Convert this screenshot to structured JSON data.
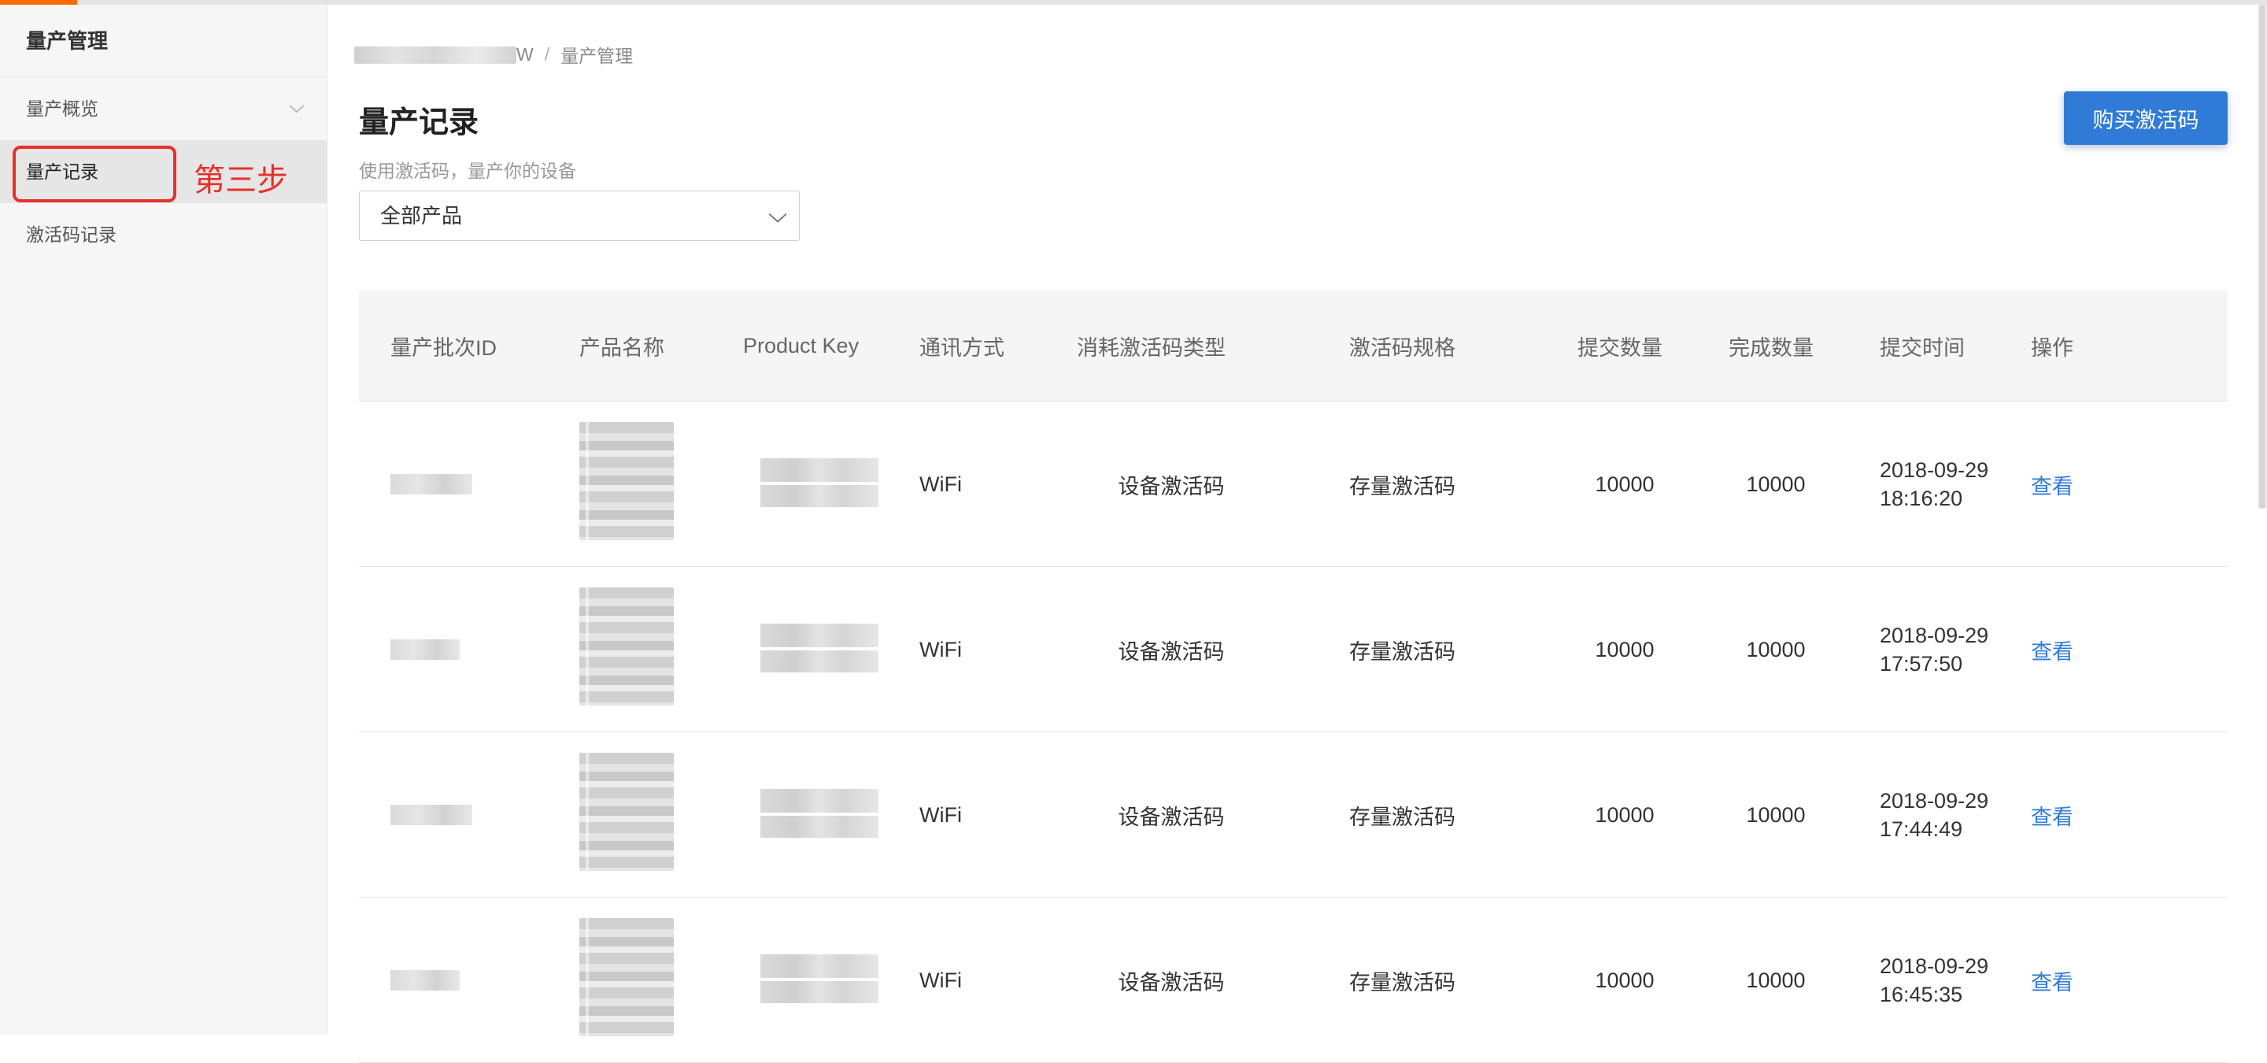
{
  "sidebar": {
    "title": "量产管理",
    "items": [
      {
        "label": "量产概览",
        "has_chevron": true
      },
      {
        "label": "量产记录",
        "active": true
      },
      {
        "label": "激活码记录"
      }
    ]
  },
  "annotation": {
    "step_label": "第三步",
    "color": "#e8302a"
  },
  "breadcrumb": {
    "current": "量产管理",
    "separator": "/",
    "prefix_suffix": "W"
  },
  "page": {
    "title": "量产记录",
    "description": "使用激活码，量产你的设备",
    "buy_button_label": "购买激活码",
    "product_filter": "全部产品"
  },
  "table": {
    "headers": [
      "量产批次ID",
      "产品名称",
      "Product Key",
      "通讯方式",
      "消耗激活码类型",
      "激活码规格",
      "提交数量",
      "完成数量",
      "提交时间",
      "操作"
    ],
    "rows": [
      {
        "comm": "WiFi",
        "code_type": "设备激活码",
        "spec": "存量激活码",
        "submitted": "10000",
        "completed": "10000",
        "time": "2018-09-29 18:16:20",
        "action": "查看"
      },
      {
        "comm": "WiFi",
        "code_type": "设备激活码",
        "spec": "存量激活码",
        "submitted": "10000",
        "completed": "10000",
        "time": "2018-09-29 17:57:50",
        "action": "查看"
      },
      {
        "comm": "WiFi",
        "code_type": "设备激活码",
        "spec": "存量激活码",
        "submitted": "10000",
        "completed": "10000",
        "time": "2018-09-29 17:44:49",
        "action": "查看"
      },
      {
        "comm": "WiFi",
        "code_type": "设备激活码",
        "spec": "存量激活码",
        "submitted": "10000",
        "completed": "10000",
        "time": "2018-09-29 16:45:35",
        "action": "查看"
      }
    ]
  },
  "colors": {
    "accent": "#ff6a00",
    "primary": "#2f7bd6",
    "highlight": "#e8302a"
  }
}
